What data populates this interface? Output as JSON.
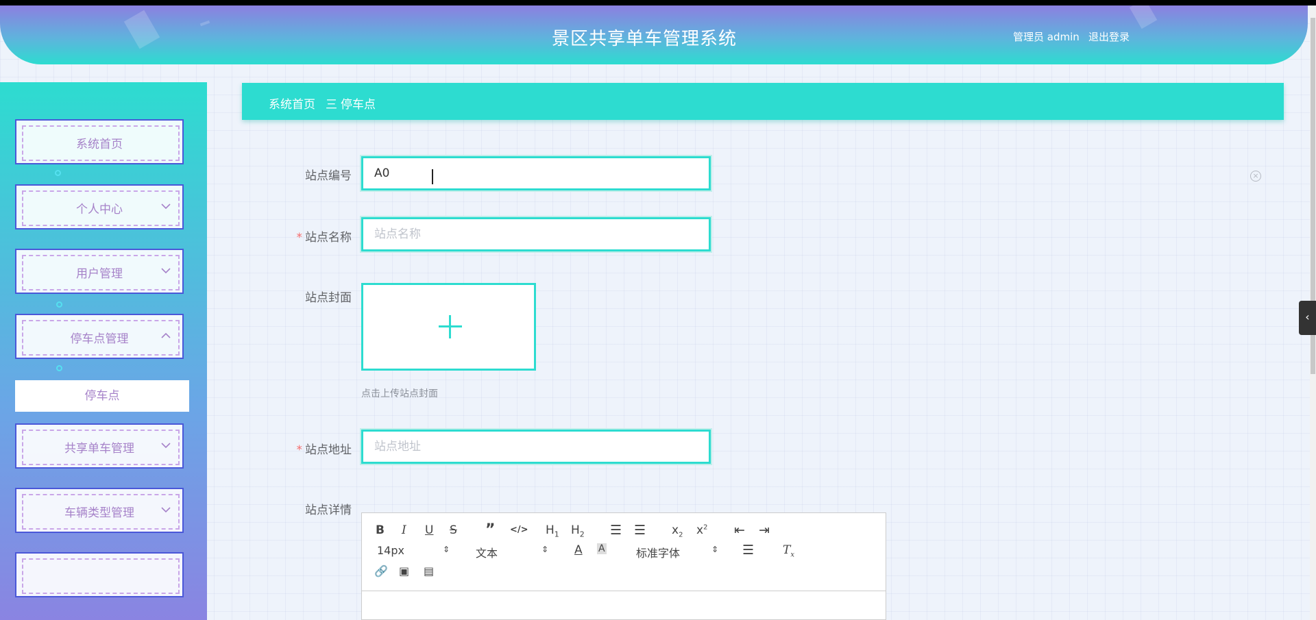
{
  "header": {
    "title": "景区共享单车管理系统",
    "user": "管理员 admin",
    "logout": "退出登录"
  },
  "sidebar": {
    "items": [
      {
        "label": "系统首页",
        "expandable": false
      },
      {
        "label": "个人中心",
        "expandable": true,
        "expanded": false
      },
      {
        "label": "用户管理",
        "expandable": true,
        "expanded": false
      },
      {
        "label": "停车点管理",
        "expandable": true,
        "expanded": true
      },
      {
        "label": "共享单车管理",
        "expandable": true,
        "expanded": false
      },
      {
        "label": "车辆类型管理",
        "expandable": true,
        "expanded": false
      }
    ],
    "sub_item": "停车点"
  },
  "breadcrumb": {
    "home": "系统首页",
    "separator": "三",
    "current": "停车点"
  },
  "form": {
    "station_no": {
      "label": "站点编号",
      "value": "A0"
    },
    "station_name": {
      "label": "站点名称",
      "placeholder": "站点名称",
      "required": true
    },
    "cover": {
      "label": "站点封面",
      "tip": "点击上传站点封面"
    },
    "address": {
      "label": "站点地址",
      "placeholder": "站点地址",
      "required": true
    },
    "detail": {
      "label": "站点详情"
    }
  },
  "editor": {
    "font_size": "14px",
    "block_type": "文本",
    "font_family": "标准字体",
    "tools": [
      "bold-icon",
      "italic-icon",
      "underline-icon",
      "strike-icon",
      "quote-icon",
      "code-icon",
      "h1-icon",
      "h2-icon",
      "ordered-list-icon",
      "bullet-list-icon",
      "subscript-icon",
      "superscript-icon",
      "outdent-icon",
      "indent-icon",
      "font-color-icon",
      "background-color-icon",
      "align-icon",
      "clear-format-icon",
      "link-icon",
      "image-icon",
      "video-icon"
    ]
  },
  "colors": {
    "accent": "#2ddcd0",
    "menu_text": "#a682c9",
    "menu_border": "#4a57d8",
    "required": "#f56c6c"
  }
}
